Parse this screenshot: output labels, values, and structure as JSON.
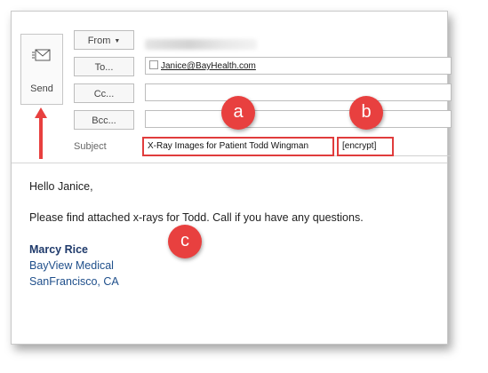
{
  "toolbar": {
    "send_label": "Send",
    "send_icon": "envelope-send-icon"
  },
  "header": {
    "from_label": "From",
    "to_label": "To...",
    "cc_label": "Cc...",
    "bcc_label": "Bcc...",
    "subject_label": "Subject"
  },
  "fields": {
    "to_recipient": "Janice@BayHealth.com",
    "cc_value": "",
    "bcc_value": "",
    "subject_text": "X-Ray Images for Patient Todd Wingman",
    "subject_tag": "[encrypt]"
  },
  "message": {
    "greeting": "Hello Janice,",
    "body": "Please find attached x-rays for Todd. Call if you have any questions.",
    "signature_name": "Marcy Rice",
    "signature_org": "BayView Medical",
    "signature_location": "SanFrancisco, CA"
  },
  "annotations": {
    "a": "a",
    "b": "b",
    "c": "c"
  },
  "colors": {
    "callout": "#e8403f",
    "highlight_border": "#e03c3c",
    "signature": "#1f4f8b"
  }
}
